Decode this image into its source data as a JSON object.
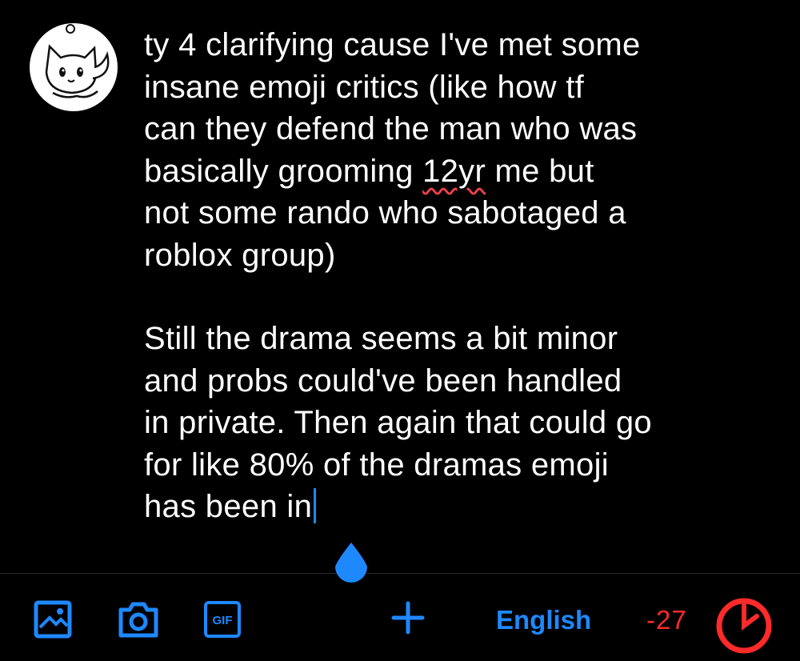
{
  "compose": {
    "paragraph1": [
      "ty 4 clarifying cause I've met some",
      "insane emoji critics (like how tf",
      "can they defend the man who was",
      [
        "basically grooming ",
        "12yr",
        " me but"
      ],
      "not some rando who sabotaged a",
      "roblox group)"
    ],
    "paragraph2": [
      "Still the drama seems a bit minor",
      "and probs could've been handled",
      "in private. Then again that could go",
      "for like 80% of the dramas emoji",
      "has been in"
    ]
  },
  "toolbar": {
    "icons": [
      "image-icon",
      "camera-icon",
      "gif-icon",
      "plus-icon"
    ],
    "gif_label": "GIF",
    "language": "English",
    "char_count": "-27"
  },
  "colors": {
    "background": "#000000",
    "text": "#ffffff",
    "accent": "#1e88ff",
    "over_limit": "#ff2a2a",
    "spellcheck": "#e8404a"
  }
}
